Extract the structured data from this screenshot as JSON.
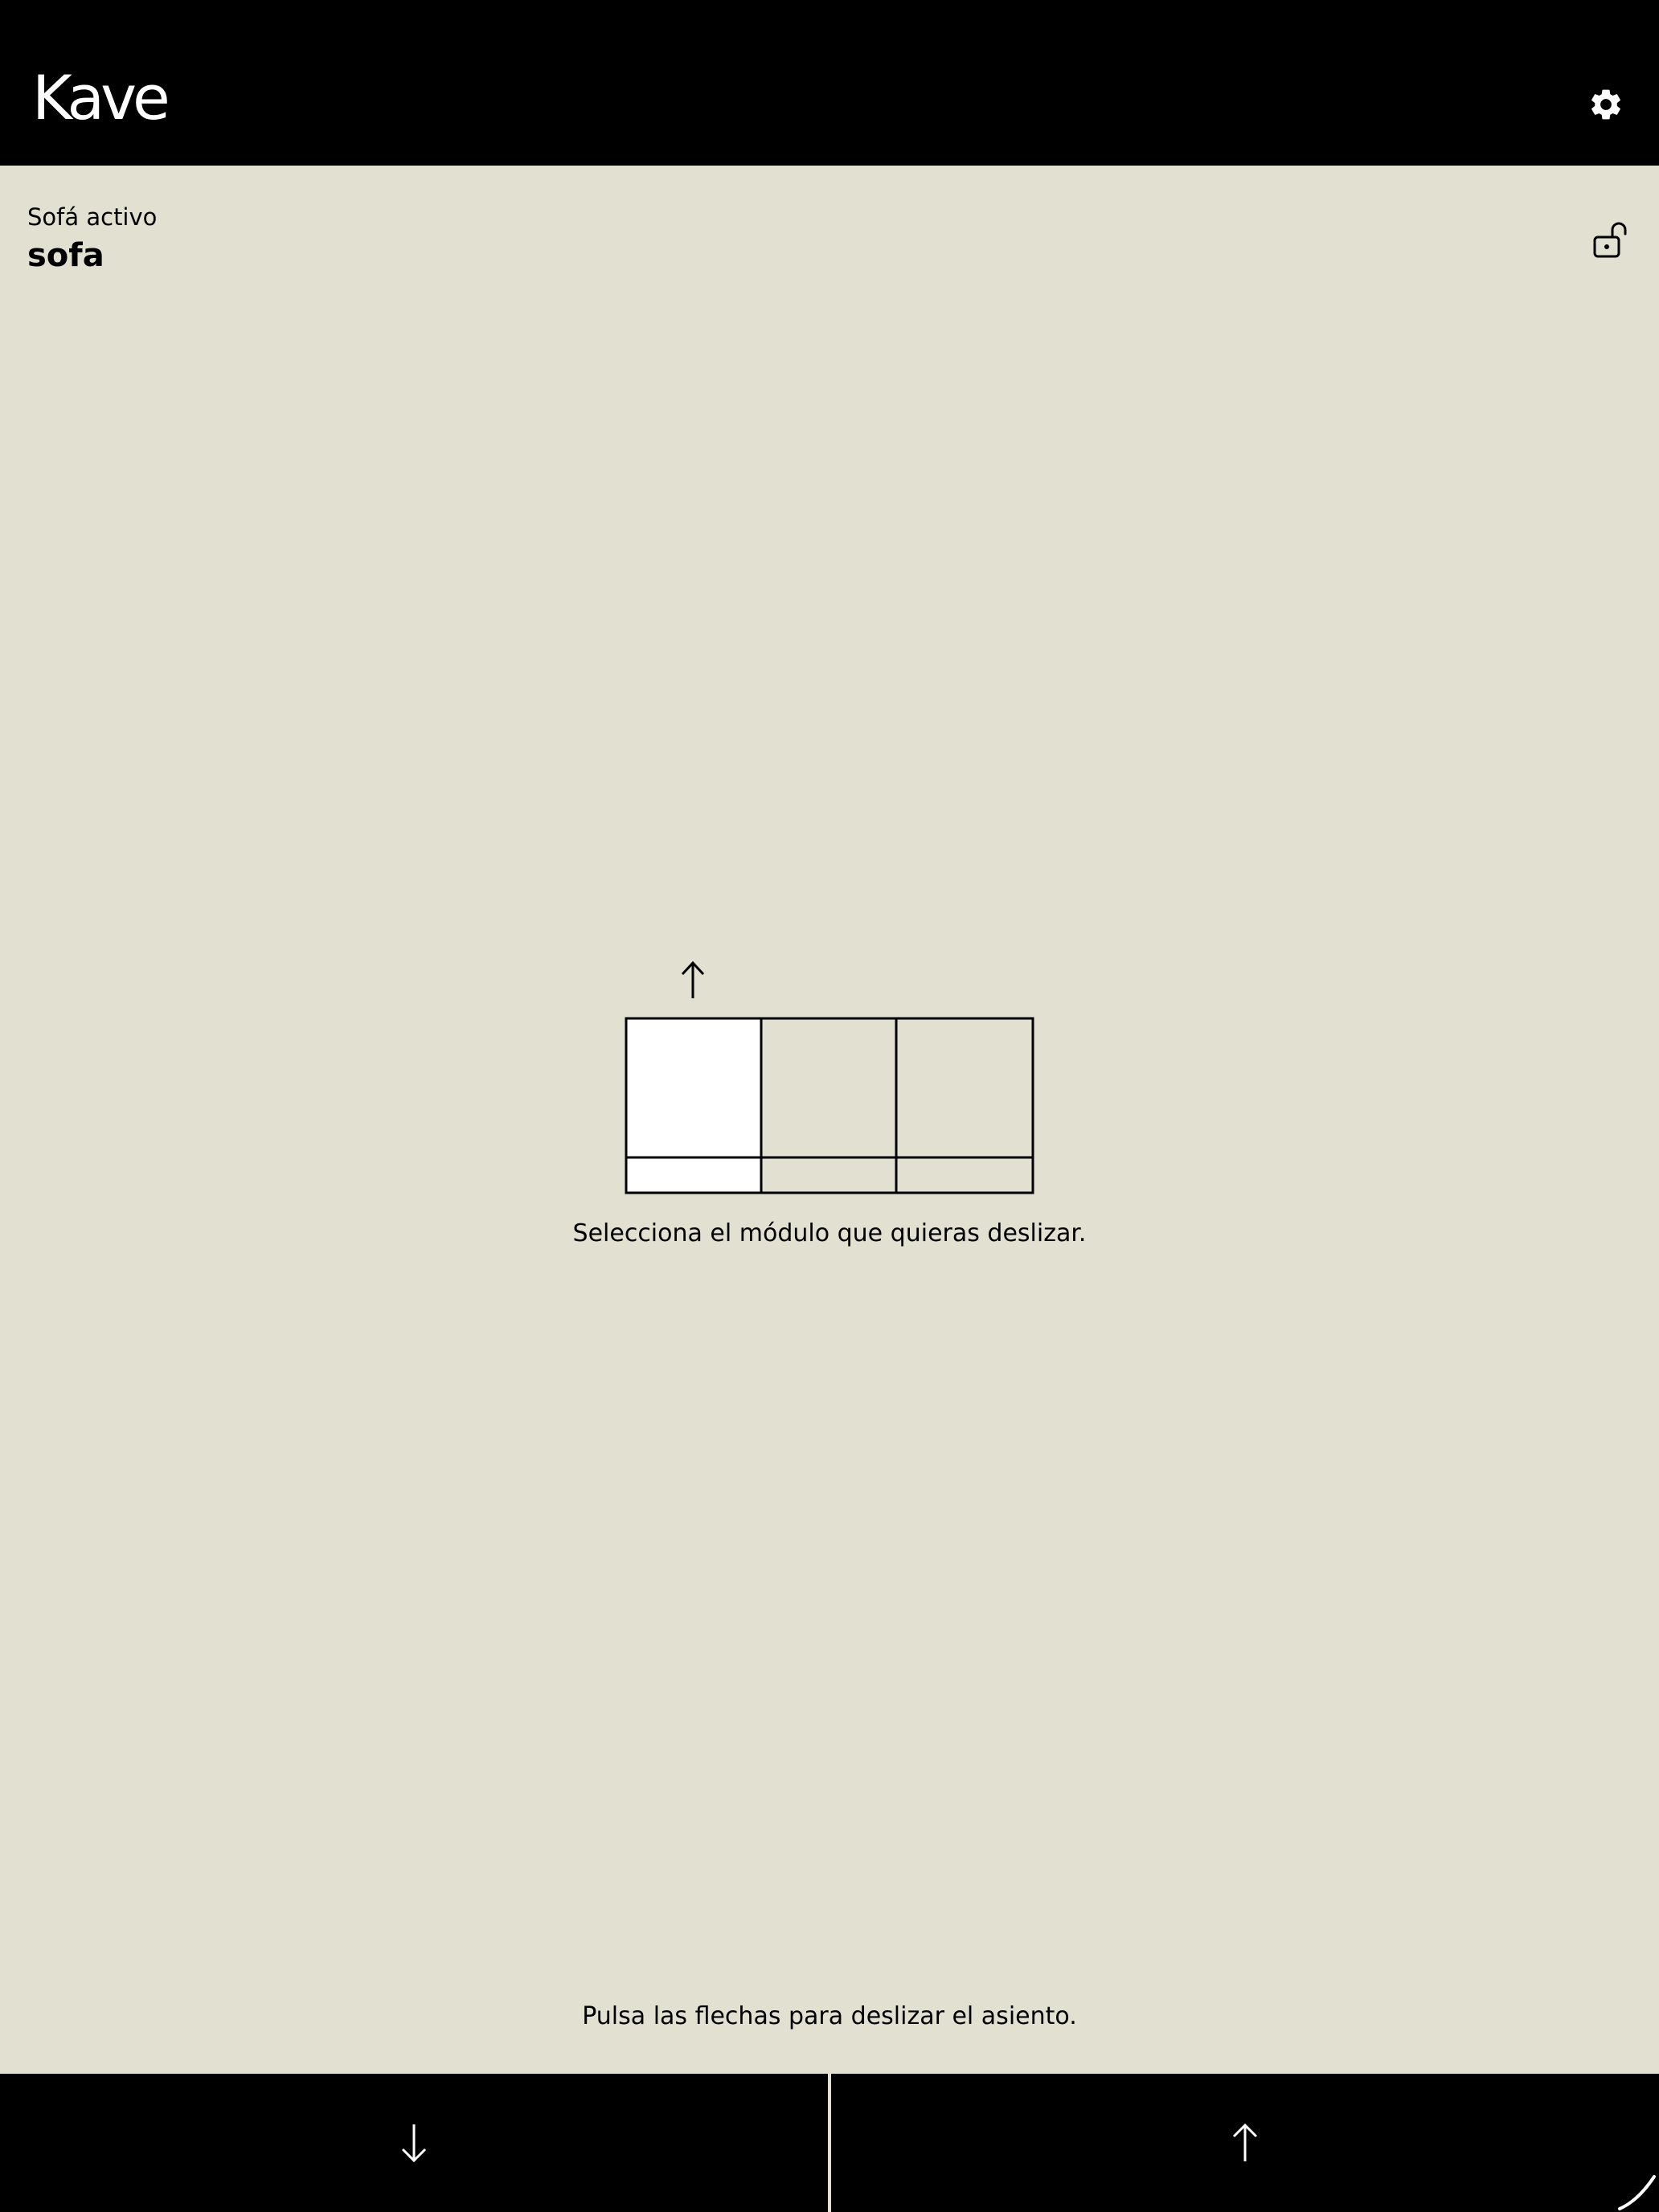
{
  "header": {
    "logo_text": "Kave",
    "settings_icon": "gear-icon"
  },
  "sofa": {
    "active_label": "Sofá activo",
    "name": "sofa",
    "lock_icon": "unlock-icon",
    "modules_count": 3,
    "selected_module_index": 0
  },
  "main": {
    "instruction": "Selecciona el módulo que quieras deslizar.",
    "hint": "Pulsa las flechas para deslizar el asiento."
  },
  "footer": {
    "down_icon": "arrow-down-icon",
    "up_icon": "arrow-up-icon"
  },
  "colors": {
    "background": "#E2E0D0",
    "bar": "#000000",
    "selected_module": "#FFFFFF"
  }
}
